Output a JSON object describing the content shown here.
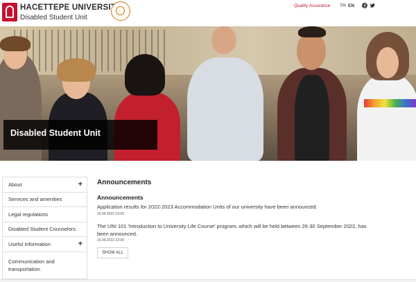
{
  "header": {
    "university_name": "HACETTEPE UNIVERSITY",
    "unit_name": "Disabled Student Unit",
    "quality_link": "Quality Assurance",
    "lang_tr": "TR",
    "lang_en": "EN",
    "social_icons": [
      "facebook-icon",
      "twitter-icon"
    ],
    "accent_color": "#c8102e"
  },
  "hero": {
    "title": "Disabled Student Unit"
  },
  "sidebar": {
    "items": [
      {
        "label": "About",
        "expandable": true
      },
      {
        "label": "Services and amenities",
        "expandable": false
      },
      {
        "label": "Legal regulations",
        "expandable": false
      },
      {
        "label": "Disabled Student Counselors",
        "expandable": false
      },
      {
        "label": "Useful Information",
        "expandable": true
      },
      {
        "label": "Communication and transportation",
        "expandable": false
      }
    ],
    "expand_symbol": "+"
  },
  "main": {
    "section_title": "Announcements",
    "list_title": "Announcements",
    "announcements": [
      {
        "text": "Application results for 2022-2023 Accommodation Units of our university have been announced.",
        "date": "15.09.2022 23:00"
      },
      {
        "text": "The UNI 101 'Introduction to University Life Course' program, which will be held between 26-30 September 2022, has been announced.",
        "date": "15.09.2022 23:00"
      }
    ],
    "show_all_label": "SHOW ALL"
  }
}
